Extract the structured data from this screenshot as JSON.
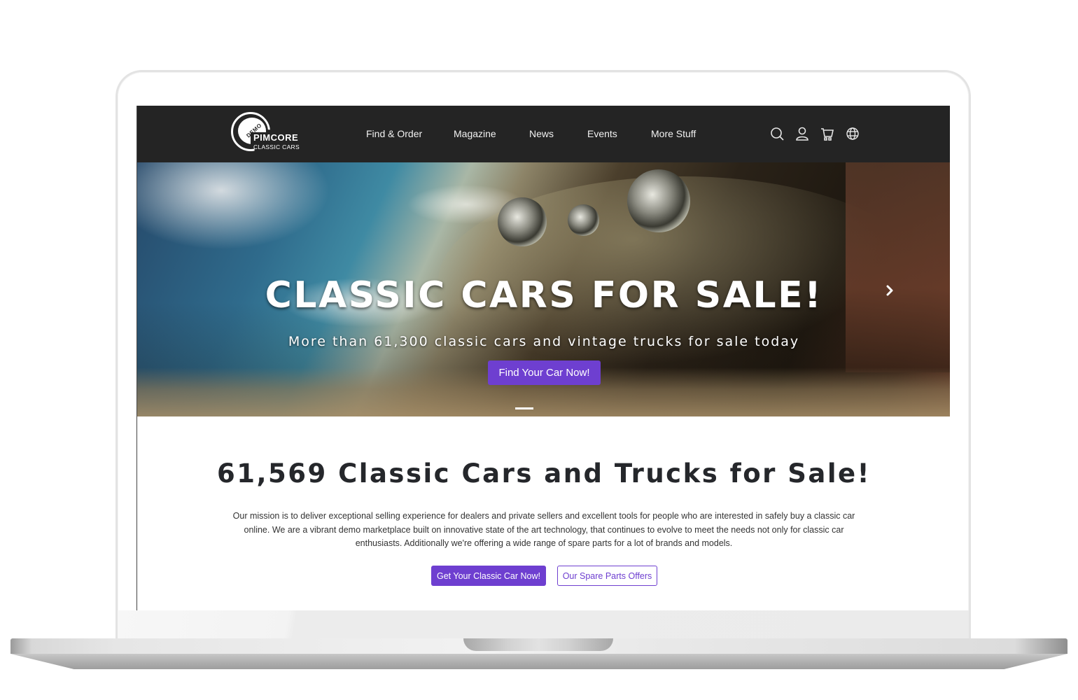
{
  "brand": {
    "badge": "DEMO",
    "name": "PIMCORE",
    "tagline": "CLASSIC CARS"
  },
  "nav": {
    "items": [
      {
        "label": "Find & Order"
      },
      {
        "label": "Magazine"
      },
      {
        "label": "News"
      },
      {
        "label": "Events"
      },
      {
        "label": "More Stuff"
      }
    ],
    "icons": [
      "search-icon",
      "user-icon",
      "cart-icon",
      "globe-icon"
    ]
  },
  "hero": {
    "title": "CLASSIC CARS FOR SALE!",
    "subtitle": "More than 61,300 classic cars and vintage trucks for sale today",
    "cta_label": "Find Your Car Now!",
    "next_icon": "chevron-right-icon",
    "active_slide": 1
  },
  "content": {
    "headline": "61,569 Classic Cars and Trucks for Sale!",
    "mission": "Our mission is to deliver exceptional selling experience for dealers and private sellers and excellent tools for people who are interested in safely buy a classic car online. We are a vibrant demo marketplace built on innovative state of the art technology, that continues to evolve to meet the needs not only for classic car enthusiasts. Additionally we're offering a wide range of spare parts for a lot of brands and models.",
    "primary_button": "Get Your Classic Car Now!",
    "secondary_button": "Our Spare Parts Offers"
  },
  "colors": {
    "accent": "#6e3fd0",
    "header_bg": "#242424",
    "headline_text": "#25272b"
  }
}
